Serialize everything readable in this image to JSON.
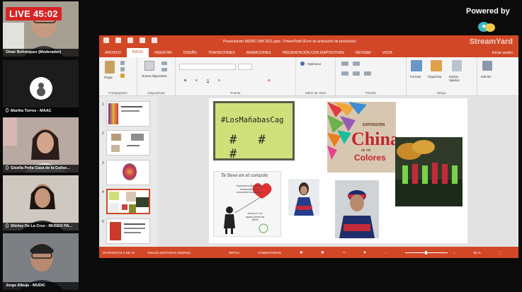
{
  "live": {
    "label": "LIVE",
    "time": "45:02"
  },
  "branding": {
    "powered_by": "Powered by",
    "watermark": "StreamYard"
  },
  "participants": [
    {
      "name": "Omar Bohórquez (Moderador)"
    },
    {
      "name": "Martha Torres - MAAC"
    },
    {
      "name": "Gisella Peña Casa de la Cultur..."
    },
    {
      "name": "Shirley De La Cruz - MUSEO PA..."
    },
    {
      "name": "Jorge Albuja - MUDIC"
    }
  ],
  "ppt": {
    "window_title": "Presentación MUDIC DIM 2021.pptx - PowerPoint (Error de activación de productos)",
    "tabs": [
      "ARCHIVO",
      "INICIO",
      "INSERTAR",
      "DISEÑO",
      "TRANSICIONES",
      "ANIMACIONES",
      "PRESENTACIÓN CON DIAPOSITIVAS",
      "REVISAR",
      "VISTA"
    ],
    "signin": "Iniciar sesión",
    "ribbon": {
      "pegar": "Pegar",
      "nueva_diapositiva": "Nueva diapositiva",
      "optimizar": "Optimizar",
      "formas": "Formas",
      "organizar": "Organizar",
      "estilos_rapidos": "Estilos rápidos",
      "edicion": "Edición",
      "groups": [
        "Portapapeles",
        "Diapositivas",
        "Fuente",
        "Salón de clase",
        "Párrafo",
        "Dibujo"
      ]
    },
    "thumb_numbers": [
      "1",
      "2",
      "3",
      "4",
      "5"
    ],
    "status": {
      "slide_info": "DIAPOSITIVA 4 DE 15",
      "language": "INGLÉS (ESTADOS UNIDOS)",
      "notas": "NOTAS",
      "comentarios": "COMENTARIOS",
      "zoom": "66 %"
    }
  },
  "slide": {
    "hashtag": "#LosMañabasCag",
    "hashes": "# # #",
    "china_top": "EXPOSICIÓN",
    "china_main": "China",
    "china_sub": "de mil",
    "china_colors": "Colores",
    "corazon_title": "Te llevo en el corazón",
    "corazon_text": "Exposición fotográfica y testimonial de la comunidad ecuatoriana",
    "corazon_date": "Jueves 27 de agosto desde las 18h00"
  },
  "colors": {
    "ppt_accent": "#d24726",
    "live_red": "#d62424"
  }
}
